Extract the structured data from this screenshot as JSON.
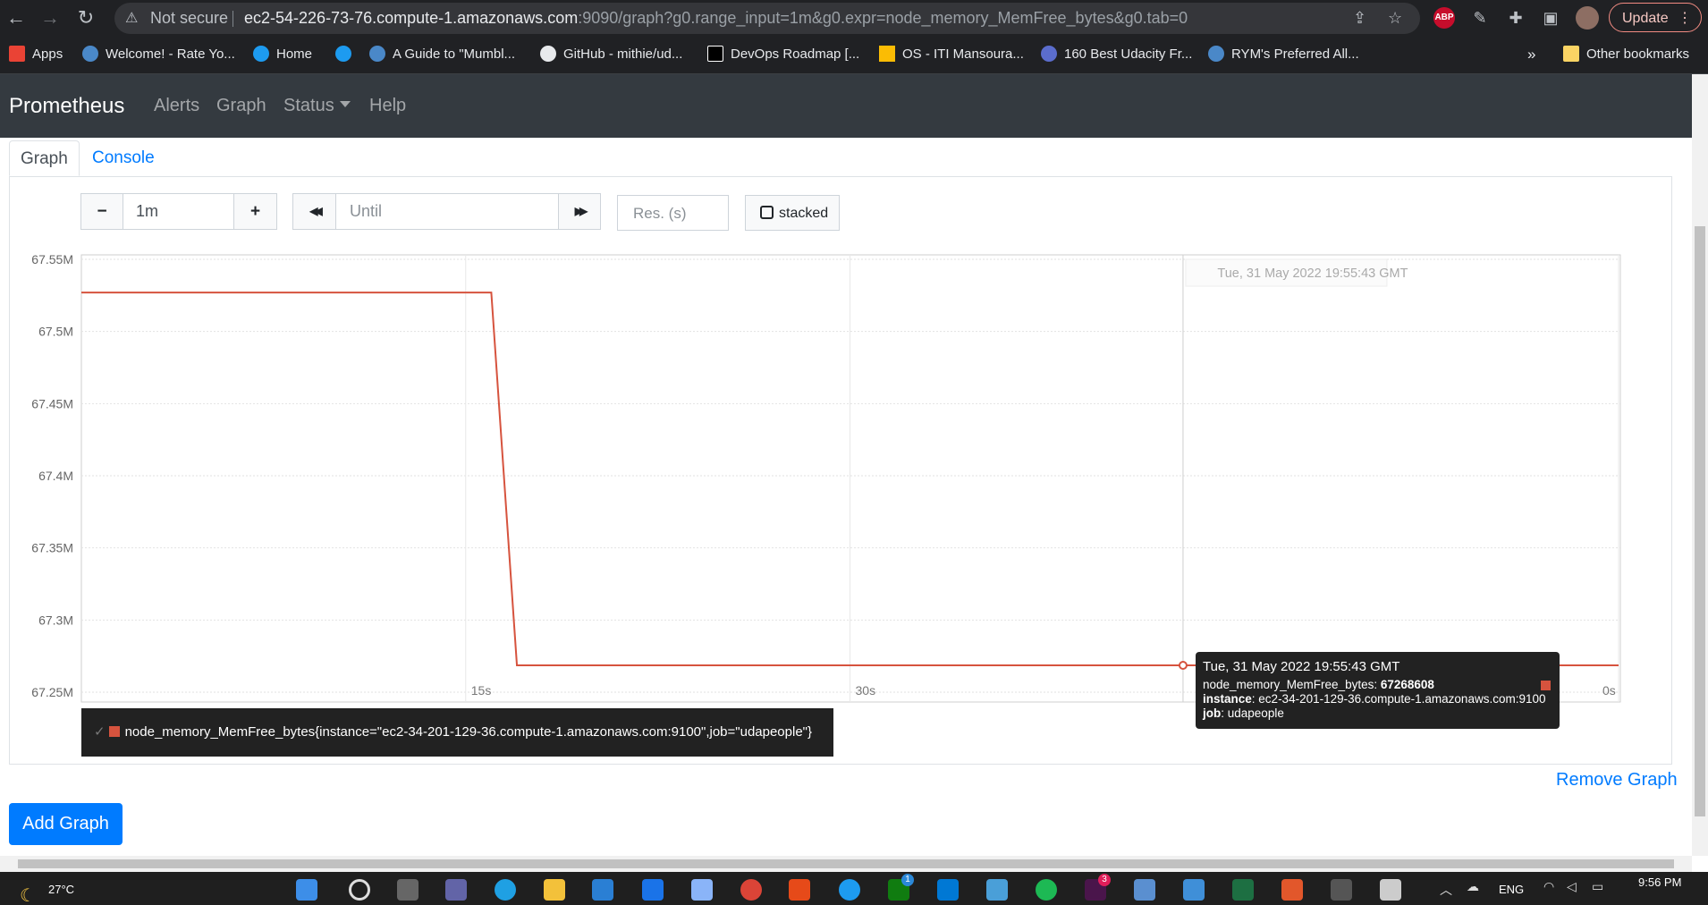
{
  "browser": {
    "security_label": "Not secure",
    "url_host": "ec2-54-226-73-76.compute-1.amazonaws.com",
    "url_rest": ":9090/graph?g0.range_input=1m&g0.expr=node_memory_MemFree_bytes&g0.tab=0",
    "abp_label": "ABP",
    "update_label": "Update"
  },
  "bookmarks": [
    {
      "label": "Apps",
      "icon": "apps-grid-icon",
      "color": "#ea4335"
    },
    {
      "label": "Welcome! - Rate Yo...",
      "icon": "globe-icon",
      "color": "#4a88c8"
    },
    {
      "label": "Home",
      "icon": "twitter-icon",
      "color": "#1d9bf0"
    },
    {
      "label": "",
      "icon": "twitter-icon",
      "color": "#1d9bf0"
    },
    {
      "label": "A Guide to \"Mumbl...",
      "icon": "globe-icon",
      "color": "#4a88c8"
    },
    {
      "label": "GitHub - mithie/ud...",
      "icon": "github-icon",
      "color": "#e8eaed"
    },
    {
      "label": "DevOps Roadmap [...",
      "icon": "dev-icon",
      "color": "#000000"
    },
    {
      "label": "OS - ITI Mansoura...",
      "icon": "drive-icon",
      "color": "#fbbc04"
    },
    {
      "label": "160 Best Udacity Fr...",
      "icon": "udacity-icon",
      "color": "#5b6dcd"
    },
    {
      "label": "RYM's Preferred All...",
      "icon": "globe-icon",
      "color": "#4a88c8"
    }
  ],
  "bookmarks_more": "»",
  "other_bookmarks": "Other bookmarks",
  "prometheus": {
    "brand": "Prometheus",
    "nav": [
      "Alerts",
      "Graph",
      "Status",
      "Help"
    ]
  },
  "tabs": {
    "graph": "Graph",
    "console": "Console"
  },
  "controls": {
    "minus": "−",
    "range_value": "1m",
    "plus": "+",
    "back": "◀◀",
    "until_placeholder": "Until",
    "forward": "▶▶",
    "res_placeholder": "Res. (s)",
    "stacked_label": "stacked"
  },
  "chart_data": {
    "type": "line",
    "y_tick_labels": [
      "67.55M",
      "67.5M",
      "67.45M",
      "67.4M",
      "67.35M",
      "67.3M",
      "67.25M"
    ],
    "ylim": [
      67250000,
      67550000
    ],
    "x_tick_labels": [
      "15s",
      "30s",
      "0s"
    ],
    "x_ticks_seconds_ago": [
      45,
      30,
      0
    ],
    "xlim_seconds_ago": [
      60,
      0
    ],
    "hover_line_label": "Tue, 31 May 2022 19:55:43 GMT",
    "series": [
      {
        "name": "node_memory_MemFree_bytes{instance=\"ec2-34-201-129-36.compute-1.amazonaws.com:9100\",job=\"udapeople\"}",
        "color": "#d6533e",
        "points": [
          {
            "seconds_ago": 60,
            "value": 67527000
          },
          {
            "seconds_ago": 44,
            "value": 67527000
          },
          {
            "seconds_ago": 43,
            "value": 67268608
          },
          {
            "seconds_ago": 0,
            "value": 67268608
          }
        ]
      }
    ],
    "highlight_point": {
      "seconds_ago": 17,
      "value": 67268608
    }
  },
  "tooltip": {
    "date": "Tue, 31 May 2022 19:55:43 GMT",
    "metric_name": "node_memory_MemFree_bytes",
    "metric_value": "67268608",
    "instance_key": "instance",
    "instance_value": "ec2-34-201-129-36.compute-1.amazonaws.com:9100",
    "job_key": "job",
    "job_value": "udapeople"
  },
  "legend": {
    "check": "✓",
    "label": "node_memory_MemFree_bytes{instance=\"ec2-34-201-129-36.compute-1.amazonaws.com:9100\",job=\"udapeople\"}"
  },
  "remove_graph": "Remove Graph",
  "add_graph": "Add Graph",
  "taskbar": {
    "weather": "27°C",
    "lang": "ENG",
    "time": "9:56 PM",
    "badges": [
      "1",
      "3"
    ]
  }
}
